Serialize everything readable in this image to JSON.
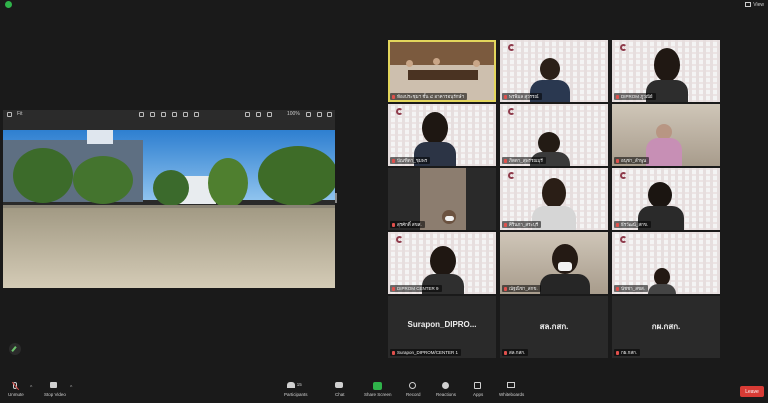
{
  "window": {
    "view_label": "View"
  },
  "share_view": {
    "title": "Fit",
    "zoom": "100%"
  },
  "participants": [
    {
      "name": "ห้องประชุมฯ ชั้น ๔ อาคารอนุรักษ์ฯ",
      "muted": true,
      "style": "room",
      "active": true
    },
    {
      "name": "พรพิมล สุวรรณ์",
      "muted": true,
      "style": "grid",
      "active": false
    },
    {
      "name": "DIPROM ภูวณีย์",
      "muted": true,
      "style": "grid",
      "active": false
    },
    {
      "name": "ปัณฑิตา_ชุมพร",
      "muted": true,
      "style": "grid",
      "active": false
    },
    {
      "name": "ภิตตา_สุพรรณบุรี",
      "muted": true,
      "style": "grid",
      "active": false
    },
    {
      "name": "อนุชา_ลำพูน",
      "muted": true,
      "style": "office",
      "active": false
    },
    {
      "name": "สุรศักดิ์ สขส.",
      "muted": true,
      "style": "dark",
      "active": false
    },
    {
      "name": "ศิรินภา_สระบุรี",
      "muted": true,
      "style": "grid",
      "active": false
    },
    {
      "name": "ธีรวัฒน์_สกข.",
      "muted": true,
      "style": "grid",
      "active": false
    },
    {
      "name": "DIPROM CENTER 9",
      "muted": true,
      "style": "grid",
      "active": false
    },
    {
      "name": "ณัฐณิชา_สกข.",
      "muted": true,
      "style": "office",
      "active": false
    },
    {
      "name": "นัชชา_สขส.",
      "muted": true,
      "style": "grid",
      "active": false
    },
    {
      "name": "Surapon_DIPROM/CENTER 1",
      "display": "Surapon_DIPRO...",
      "muted": true,
      "style": "dark",
      "active": false
    },
    {
      "name": "สล.กสก.",
      "display": "สล.กสก.",
      "muted": true,
      "style": "dark",
      "active": false
    },
    {
      "name": "กผ.กสก.",
      "display": "กผ.กสก.",
      "muted": true,
      "style": "dark",
      "active": false
    }
  ],
  "toolbar": {
    "unmute": "Unmute",
    "stop_video": "Stop Video",
    "participants": "Participants",
    "participants_count": "15",
    "chat": "Chat",
    "share_screen": "Share Screen",
    "record": "Record",
    "reactions": "Reactions",
    "apps": "Apps",
    "whiteboards": "Whiteboards",
    "leave": "Leave"
  },
  "colors": {
    "background": "#1a1a1a",
    "active_speaker": "#e3d65c",
    "share_green": "#2fb34a",
    "leave_red": "#d83b35",
    "muted_red": "#e0504c"
  }
}
